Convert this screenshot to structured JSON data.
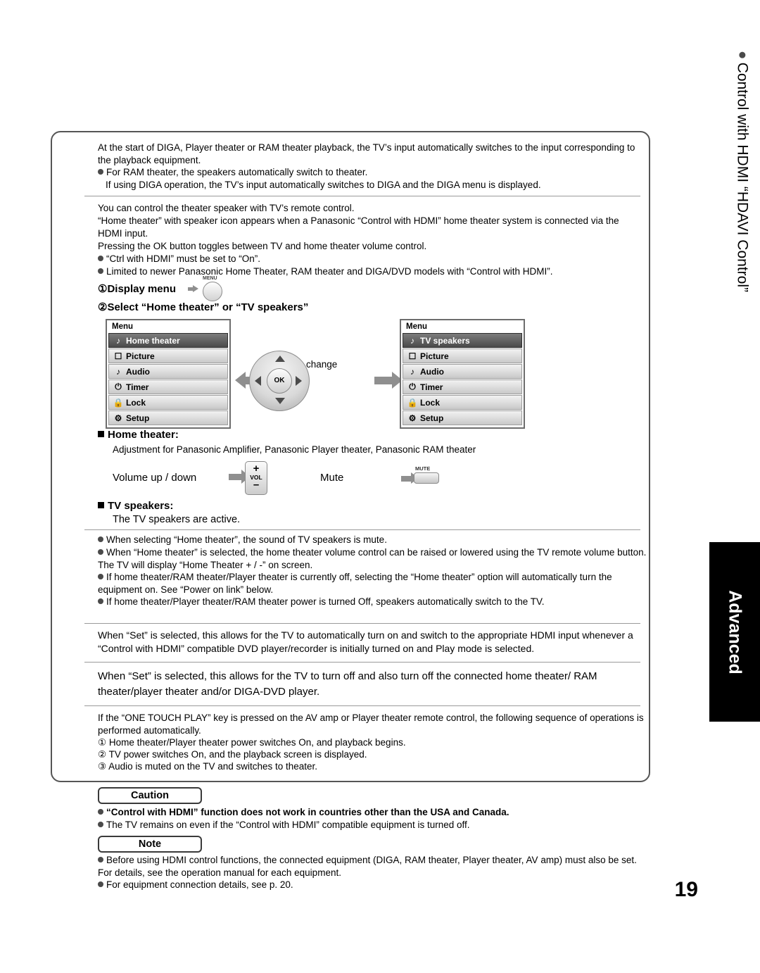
{
  "doc": {
    "page_number": "19",
    "side_tab_label": "Advanced",
    "side_vertical_text": "Control with HDMI “HDAVI Control”"
  },
  "sections": {
    "intro": {
      "para1": "At the start of DIGA, Player theater or RAM theater playback, the TV’s input automatically switches to the input corresponding to the playback equipment.",
      "bullet1": "For RAM theater, the speakers automatically switch to theater.",
      "para2": "If using DIGA operation, the TV’s input automatically switches to DIGA and the DIGA menu is displayed."
    },
    "speaker": {
      "para1": "You can control the theater speaker with TV’s remote control.",
      "para2": "“Home theater” with speaker icon appears when a Panasonic “Control with HDMI” home theater system is connected via the HDMI input.",
      "para3": "Pressing the OK button toggles between TV and home theater volume control.",
      "bullet1": "“Ctrl with HDMI” must be set to “On”.",
      "bullet2": "Limited to newer Panasonic Home Theater, RAM theater and DIGA/DVD models with “Control with HDMI”."
    },
    "steps": {
      "step1": "①Display menu",
      "step1_icon": "menu-remote-button",
      "step2": "②Select “Home theater” or “TV speakers”",
      "change_label": "change"
    },
    "menu_left": {
      "title": "Menu",
      "items": [
        {
          "label": "Home theater",
          "icon": "speaker-icon",
          "selected": true
        },
        {
          "label": "Picture",
          "icon": "picture-icon",
          "selected": false
        },
        {
          "label": "Audio",
          "icon": "note-icon",
          "selected": false
        },
        {
          "label": "Timer",
          "icon": "power-icon",
          "selected": false
        },
        {
          "label": "Lock",
          "icon": "lock-icon",
          "selected": false
        },
        {
          "label": "Setup",
          "icon": "setup-icon",
          "selected": false
        }
      ]
    },
    "menu_right": {
      "title": "Menu",
      "items": [
        {
          "label": "TV speakers",
          "icon": "speaker-icon",
          "selected": true
        },
        {
          "label": "Picture",
          "icon": "picture-icon",
          "selected": false
        },
        {
          "label": "Audio",
          "icon": "note-icon",
          "selected": false
        },
        {
          "label": "Timer",
          "icon": "power-icon",
          "selected": false
        },
        {
          "label": "Lock",
          "icon": "lock-icon",
          "selected": false
        },
        {
          "label": "Setup",
          "icon": "setup-icon",
          "selected": false
        }
      ]
    },
    "remote": {
      "ok_label": "OK",
      "menu_label": "MENU",
      "vol_plus": "+",
      "vol_label": "VOL",
      "vol_minus": "–",
      "mute_label": "MUTE"
    },
    "home_theater": {
      "heading": "Home theater:",
      "desc": "Adjustment for Panasonic Amplifier, Panasonic Player theater, Panasonic RAM theater",
      "volume_label": "Volume up / down",
      "mute_label": "Mute"
    },
    "tv_speakers": {
      "heading": "TV speakers:",
      "desc": "The TV speakers are active."
    },
    "notes": {
      "n1": "When selecting “Home theater”, the sound of TV speakers is mute.",
      "n2": "When “Home theater” is selected, the home theater volume control can be raised or lowered using the TV remote volume button. The TV will display “Home Theater + / -” on screen.",
      "n3": "If home theater/RAM theater/Player theater is currently off,  selecting the “Home theater” option will automatically turn the equipment on. See “Power on link” below.",
      "n4": "If home theater/Player theater/RAM theater power is turned Off, speakers automatically switch to the TV."
    },
    "power_on_link": {
      "text": "When “Set” is selected, this allows for the TV to automatically turn on and switch to the appropriate HDMI input whenever a “Control with HDMI” compatible DVD player/recorder is initially turned on and Play mode is selected."
    },
    "power_off_link": {
      "text": "When “Set” is selected, this allows for the TV to turn off and also turn off the connected home theater/ RAM theater/player theater and/or DIGA-DVD player."
    },
    "one_touch": {
      "intro": "If the “ONE TOUCH PLAY” key is pressed on the AV amp or Player theater remote control, the following sequence of operations is performed automatically.",
      "s1": "① Home theater/Player theater power switches On, and playback begins.",
      "s2": "② TV power switches On, and the playback screen is displayed.",
      "s3": "③ Audio is muted on the TV and switches to theater."
    },
    "caution": {
      "label": "Caution",
      "b1": "“Control with HDMI” function does not work in countries other than the USA and Canada.",
      "b2": "The TV remains on even if the “Control with HDMI” compatible equipment is turned off."
    },
    "note": {
      "label": "Note",
      "b1": "Before using HDMI control functions, the connected equipment (DIGA, RAM theater, Player theater, AV amp) must also be set. For details, see the operation manual for each equipment.",
      "b2": "For equipment connection details, see p. 20."
    }
  }
}
